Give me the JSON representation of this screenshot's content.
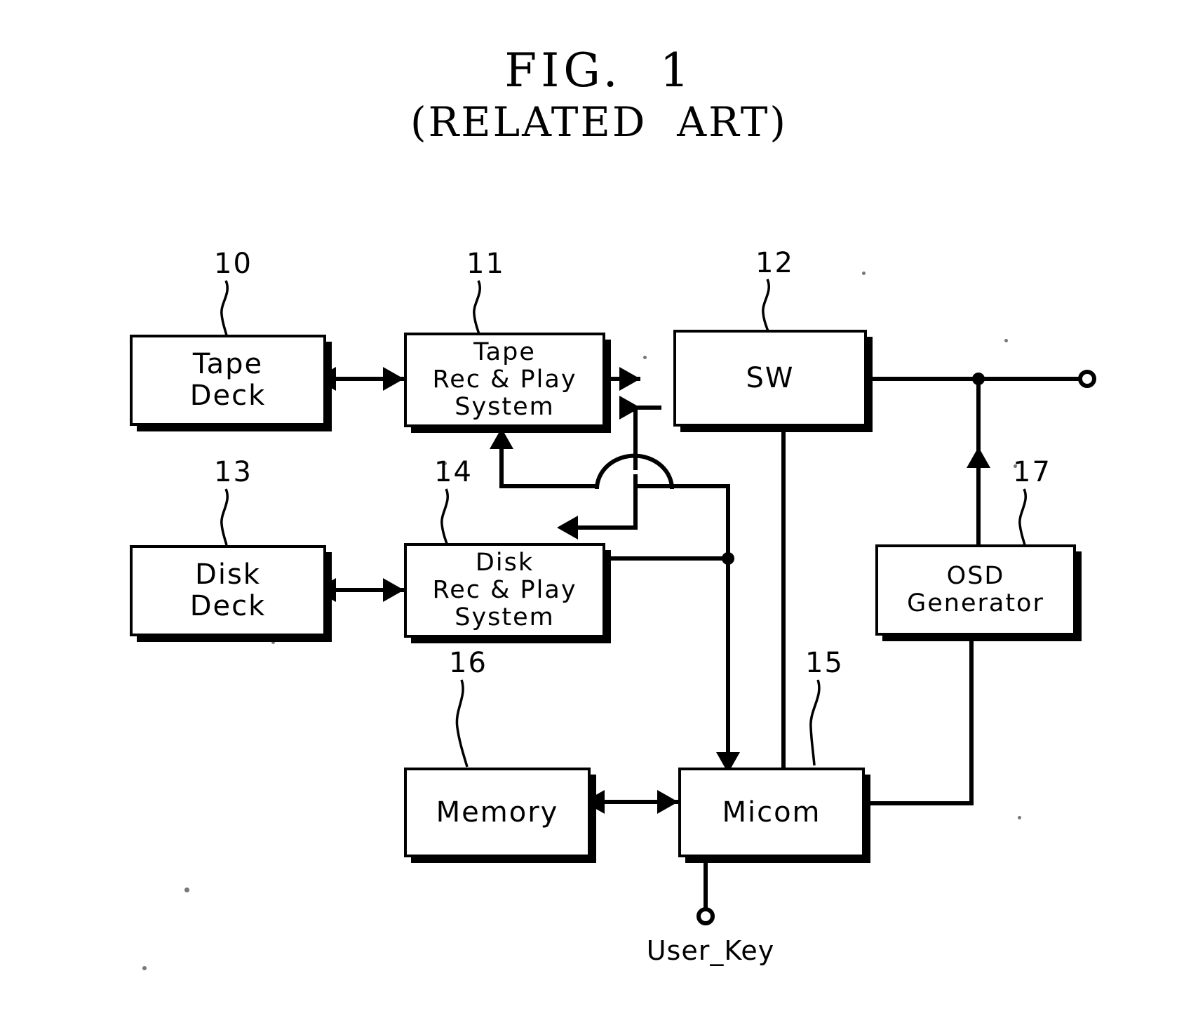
{
  "figure": {
    "title": "FIG.  1",
    "subtitle": "(RELATED  ART)"
  },
  "blocks": [
    {
      "id": "tape-deck",
      "ref": "10",
      "lines": [
        "Tape",
        "Deck"
      ]
    },
    {
      "id": "tape-rec-play",
      "ref": "11",
      "lines": [
        "Tape",
        "Rec & Play",
        "System"
      ]
    },
    {
      "id": "sw",
      "ref": "12",
      "lines": [
        "SW"
      ]
    },
    {
      "id": "disk-deck",
      "ref": "13",
      "lines": [
        "Disk",
        "Deck"
      ]
    },
    {
      "id": "disk-rec-play",
      "ref": "14",
      "lines": [
        "Disk",
        "Rec & Play",
        "System"
      ]
    },
    {
      "id": "micom",
      "ref": "15",
      "lines": [
        "Micom"
      ]
    },
    {
      "id": "memory",
      "ref": "16",
      "lines": [
        "Memory"
      ]
    },
    {
      "id": "osd-generator",
      "ref": "17",
      "lines": [
        "OSD",
        "Generator"
      ]
    }
  ],
  "terminals": [
    {
      "id": "user-key",
      "label": "User_Key"
    },
    {
      "id": "sw-output",
      "label": ""
    }
  ],
  "colors": {
    "ink": "#000000",
    "paper": "#ffffff"
  }
}
